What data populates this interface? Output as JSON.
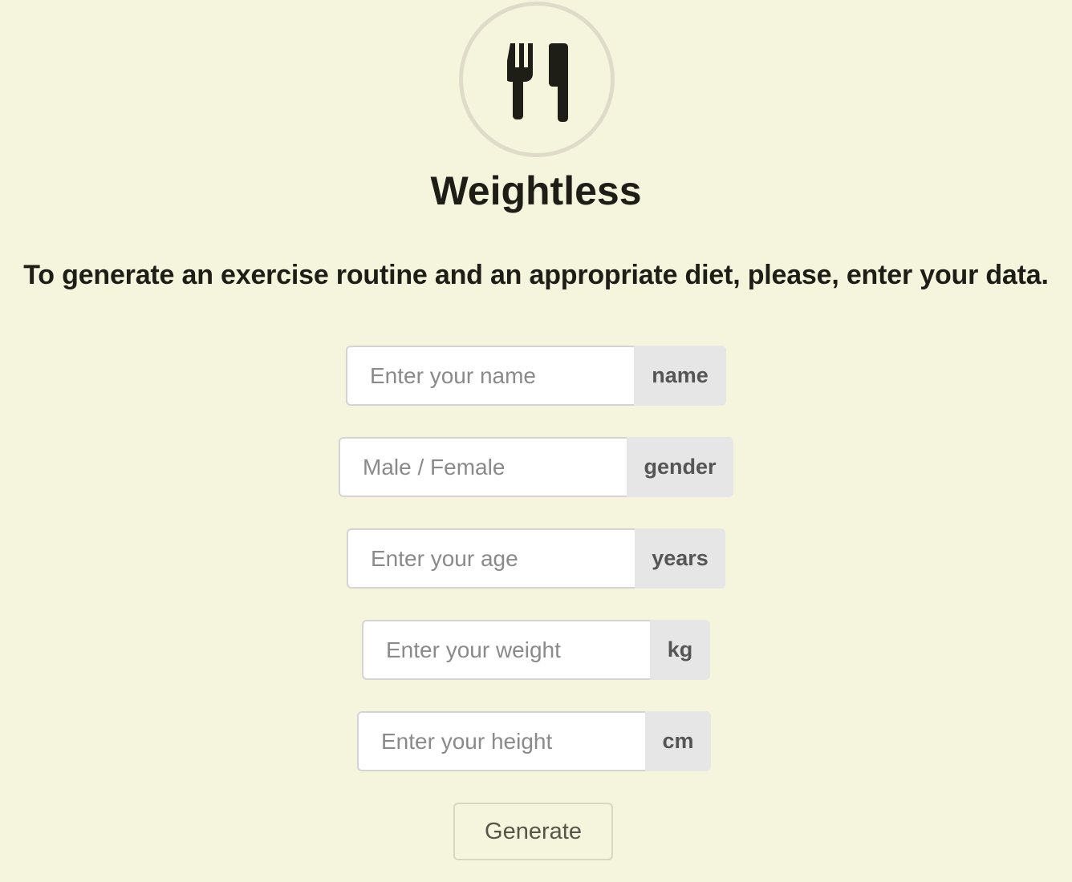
{
  "app": {
    "logo_icon": "fork-and-knife-icon",
    "title": "Weightless",
    "subtitle": "To generate an exercise routine and an appropriate diet, please, enter your data."
  },
  "form": {
    "name": {
      "placeholder": "Enter your name",
      "value": "",
      "addon": "name"
    },
    "gender": {
      "placeholder": "Male / Female",
      "value": "",
      "addon": "gender"
    },
    "age": {
      "placeholder": "Enter your age",
      "value": "",
      "addon": "years"
    },
    "weight": {
      "placeholder": "Enter your weight",
      "value": "",
      "addon": "kg"
    },
    "height": {
      "placeholder": "Enter your height",
      "value": "",
      "addon": "cm"
    },
    "submit_label": "Generate"
  },
  "colors": {
    "background": "#f5f4dc",
    "logo_ring": "#dedcc8",
    "text": "#1e1e17",
    "addon_bg": "#e6e6e6"
  }
}
